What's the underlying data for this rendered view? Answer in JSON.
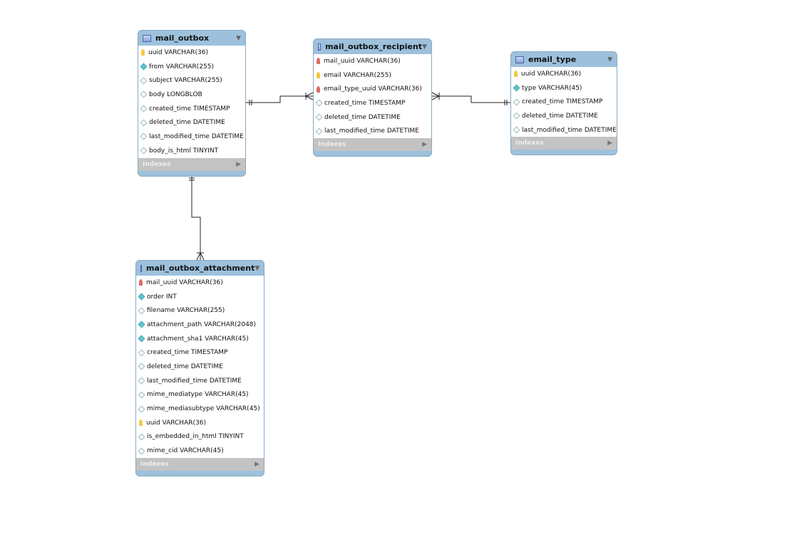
{
  "tables": [
    {
      "id": "mail_outbox",
      "name": "mail_outbox",
      "indexes_label": "Indexes",
      "columns": [
        {
          "kind": "pk",
          "text": "uuid VARCHAR(36)"
        },
        {
          "kind": "nn",
          "text": "from VARCHAR(255)"
        },
        {
          "kind": "nul",
          "text": "subject VARCHAR(255)"
        },
        {
          "kind": "nul",
          "text": "body LONGBLOB"
        },
        {
          "kind": "nul",
          "text": "created_time TIMESTAMP"
        },
        {
          "kind": "nul",
          "text": "deleted_time DATETIME"
        },
        {
          "kind": "nul",
          "text": "last_modified_time DATETIME"
        },
        {
          "kind": "nul",
          "text": "body_is_html TINYINT"
        }
      ]
    },
    {
      "id": "mail_outbox_recipient",
      "name": "mail_outbox_recipient",
      "indexes_label": "Indexes",
      "columns": [
        {
          "kind": "fk",
          "text": "mail_uuid VARCHAR(36)"
        },
        {
          "kind": "pk",
          "text": "email VARCHAR(255)"
        },
        {
          "kind": "fk",
          "text": "email_type_uuid VARCHAR(36)"
        },
        {
          "kind": "nul",
          "text": "created_time TIMESTAMP"
        },
        {
          "kind": "nul",
          "text": "deleted_time DATETIME"
        },
        {
          "kind": "nul",
          "text": "last_modified_time DATETIME"
        }
      ]
    },
    {
      "id": "email_type",
      "name": "email_type",
      "indexes_label": "Indexes",
      "columns": [
        {
          "kind": "pk",
          "text": "uuid VARCHAR(36)"
        },
        {
          "kind": "nn",
          "text": "type VARCHAR(45)"
        },
        {
          "kind": "nul",
          "text": "created_time TIMESTAMP"
        },
        {
          "kind": "nul",
          "text": "deleted_time DATETIME"
        },
        {
          "kind": "nul",
          "text": "last_modified_time DATETIME"
        }
      ]
    },
    {
      "id": "mail_outbox_attachment",
      "name": "mail_outbox_attachment",
      "indexes_label": "Indexes",
      "columns": [
        {
          "kind": "fk",
          "text": "mail_uuid VARCHAR(36)"
        },
        {
          "kind": "nn",
          "text": "order INT"
        },
        {
          "kind": "nul",
          "text": "filename VARCHAR(255)"
        },
        {
          "kind": "nn",
          "text": "attachment_path VARCHAR(2048)"
        },
        {
          "kind": "nn",
          "text": "attachment_sha1 VARCHAR(45)"
        },
        {
          "kind": "nul",
          "text": "created_time TIMESTAMP"
        },
        {
          "kind": "nul",
          "text": "deleted_time DATETIME"
        },
        {
          "kind": "nul",
          "text": "last_modified_time DATETIME"
        },
        {
          "kind": "nul",
          "text": "mime_mediatype VARCHAR(45)"
        },
        {
          "kind": "nul",
          "text": "mime_mediasubtype VARCHAR(45)"
        },
        {
          "kind": "pk",
          "text": "uuid VARCHAR(36)"
        },
        {
          "kind": "nul",
          "text": "is_embedded_in_html TINYINT"
        },
        {
          "kind": "nul",
          "text": "mime_cid VARCHAR(45)"
        }
      ]
    }
  ],
  "relationships": [
    {
      "from": "mail_outbox",
      "to": "mail_outbox_recipient",
      "type": "one-to-many"
    },
    {
      "from": "email_type",
      "to": "mail_outbox_recipient",
      "type": "one-to-many"
    },
    {
      "from": "mail_outbox",
      "to": "mail_outbox_attachment",
      "type": "one-to-many"
    }
  ],
  "colors": {
    "header": "#9dc1dc",
    "indexes_bar": "#c3c3c3",
    "pk": "#f3c93c",
    "fk": "#de6b63",
    "not_null": "#5cc7d2"
  }
}
